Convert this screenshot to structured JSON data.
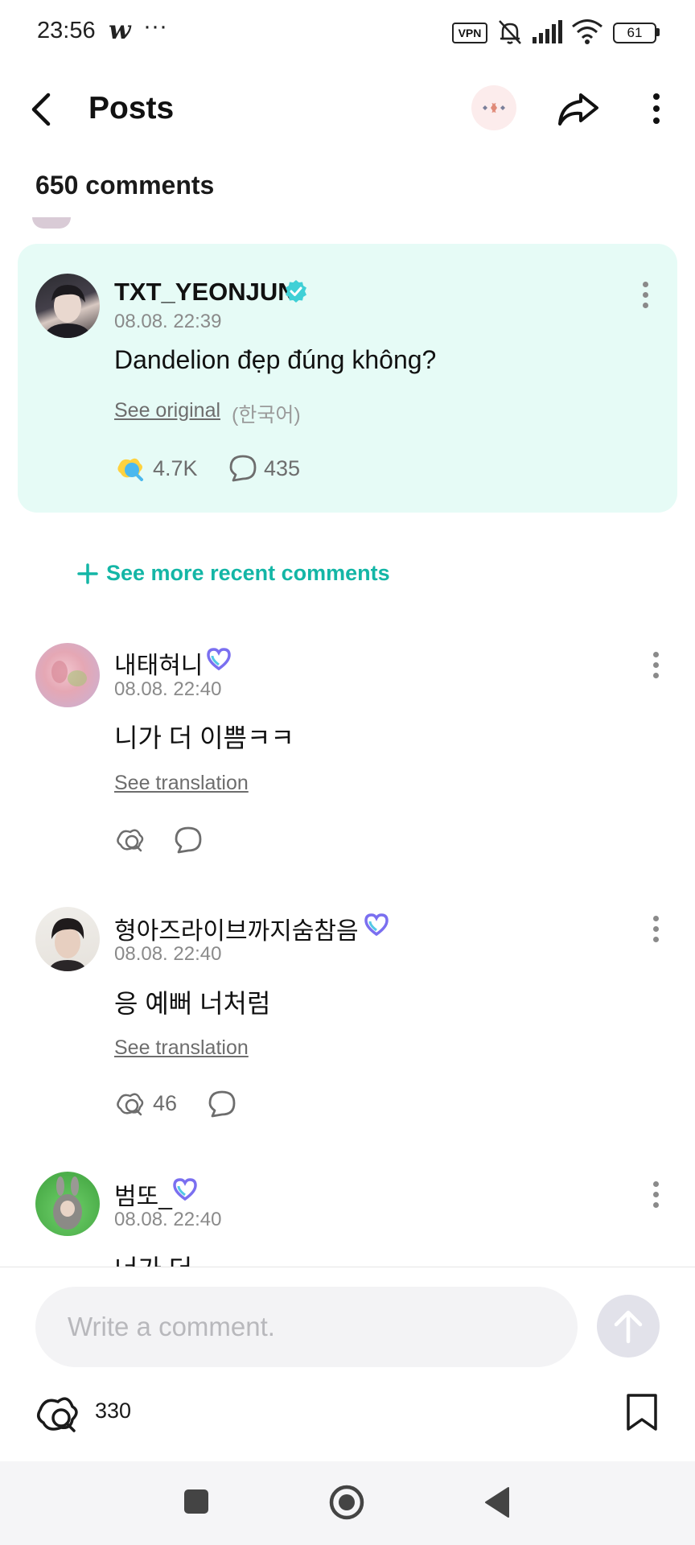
{
  "status": {
    "time": "23:56",
    "app_glyph": "w",
    "dots": "···",
    "vpn": "VPN",
    "battery": "61"
  },
  "header": {
    "title": "Posts"
  },
  "comments_header": {
    "count": "650 comments"
  },
  "highlight": {
    "username": "TXT_YEONJUN",
    "date": "08.08. 22:39",
    "text": "Dandelion đẹp đúng không?",
    "see_original": "See original",
    "language": "(한국어)",
    "likes": "4.7K",
    "replies": "435"
  },
  "see_more": "See more recent comments",
  "comments": [
    {
      "username": "내태혀니",
      "date": "08.08. 22:40",
      "text": "니가 더 이쁨ㅋㅋ",
      "see_translation": "See translation",
      "likes": ""
    },
    {
      "username": "형아즈라이브까지숨참음",
      "date": "08.08. 22:40",
      "text": "응 예뻐 너처럼",
      "see_translation": "See translation",
      "likes": "46"
    },
    {
      "username": "범또_",
      "date": "08.08. 22:40",
      "text": "너가 더"
    }
  ],
  "composer": {
    "placeholder": "Write a comment.",
    "likes": "330"
  },
  "colors": {
    "accent": "#14b6a6",
    "highlight_bg": "#e6fbf6",
    "verified": "#3fd0d6"
  },
  "icons": [
    "back-arrow-icon",
    "share-icon",
    "more-vertical-icon",
    "verified-badge-icon",
    "heart-badge-icon",
    "reaction-icon",
    "comment-bubble-icon",
    "plus-icon",
    "send-arrow-icon",
    "bookmark-icon",
    "nav-square-icon",
    "nav-circle-icon",
    "nav-back-icon"
  ]
}
